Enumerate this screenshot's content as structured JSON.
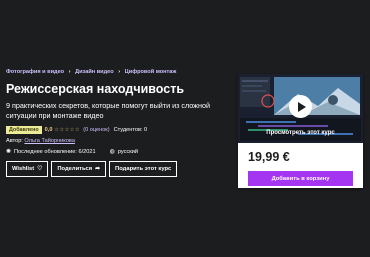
{
  "breadcrumb": {
    "items": [
      "Фотография и видео",
      "Дизайн видео",
      "Цифровой монтаж"
    ],
    "separator": "›"
  },
  "course": {
    "title": "Режиссерская находчивость",
    "subtitle": "9 практических секретов, которые помогут выйти из сложной ситуации при монтаже видео",
    "badge": "Добавлено",
    "rating": "0,0",
    "stars": "☆☆☆☆☆",
    "rating_count": "(0 оценок)",
    "students": "Студентов: 0",
    "author_label": "Автор:",
    "author": "Ольга Тайорникова",
    "updated": "Последнее обновление: 6/2021",
    "language": "русский"
  },
  "actions": {
    "wishlist": "Wishlist",
    "share": "Поделиться",
    "gift": "Подарить этот курс"
  },
  "sidebar": {
    "preview_label": "Просмотреть этот курс",
    "price": "19,99 €",
    "cart": "Добавить в корзину"
  },
  "colors": {
    "background": "#1c1d1f",
    "link": "#cec0fc",
    "accent": "#a435f0",
    "badge": "#eceb98",
    "star": "#f3ca8c"
  },
  "icons": {
    "wishlist": "heart-icon",
    "share": "share-arrow-icon",
    "updated": "alert-badge-icon",
    "language": "globe-icon"
  }
}
